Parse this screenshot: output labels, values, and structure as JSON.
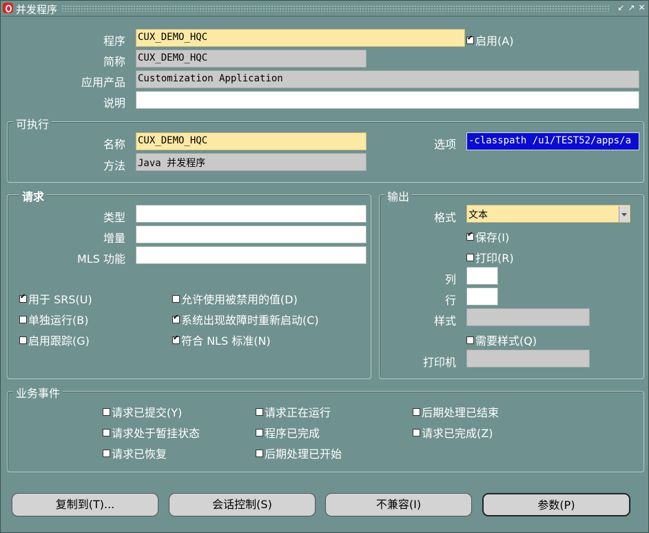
{
  "window": {
    "title": "并发程序"
  },
  "program": {
    "program_label": "程序",
    "program_value": "CUX_DEMO_HQC",
    "enabled_label": "启用(A)",
    "enabled_checked": true,
    "short_name_label": "简称",
    "short_name_value": "CUX_DEMO_HQC",
    "application_label": "应用产品",
    "application_value": "Customization Application",
    "description_label": "说明",
    "description_value": ""
  },
  "executable": {
    "group_title": "可执行",
    "name_label": "名称",
    "name_value": "CUX_DEMO_HQC",
    "options_label": "选项",
    "options_value": "-classpath /u1/TEST52/apps/a",
    "method_label": "方法",
    "method_value": "Java 并发程序"
  },
  "request": {
    "group_title": "请求",
    "type_label": "类型",
    "type_value": "",
    "incrementor_label": "增量",
    "incrementor_value": "",
    "mls_label": "MLS 功能",
    "mls_value": "",
    "checkboxes": [
      {
        "label": "用于 SRS(U)",
        "checked": true
      },
      {
        "label": "单独运行(B)",
        "checked": false
      },
      {
        "label": "启用跟踪(G)",
        "checked": false
      },
      {
        "label": "允许使用被禁用的值(D)",
        "checked": false
      },
      {
        "label": "系统出现故障时重新启动(C)",
        "checked": true
      },
      {
        "label": "符合 NLS 标准(N)",
        "checked": true
      }
    ]
  },
  "output": {
    "group_title": "输出",
    "format_label": "格式",
    "format_value": "文本",
    "save_label": "保存(I)",
    "save_checked": true,
    "print_label": "打印(R)",
    "print_checked": false,
    "columns_label": "列",
    "columns_value": "",
    "rows_label": "行",
    "rows_value": "",
    "style_label": "样式",
    "style_value": "",
    "style_required_label": "需要样式(Q)",
    "style_required_checked": false,
    "printer_label": "打印机",
    "printer_value": ""
  },
  "business_events": {
    "group_title": "业务事件",
    "checkboxes": [
      {
        "label": "请求已提交(Y)",
        "checked": false
      },
      {
        "label": "请求处于暂挂状态",
        "checked": false
      },
      {
        "label": "请求已恢复",
        "checked": false
      },
      {
        "label": "请求正在运行",
        "checked": false
      },
      {
        "label": "程序已完成",
        "checked": false
      },
      {
        "label": "后期处理已开始",
        "checked": false
      },
      {
        "label": "后期处理已结束",
        "checked": false
      },
      {
        "label": "请求已完成(Z)",
        "checked": false
      }
    ]
  },
  "buttons": {
    "copy_to": "复制到(T)...",
    "session_control": "会话控制(S)",
    "incompatibilities": "不兼容(I)",
    "parameters": "参数(P)"
  }
}
